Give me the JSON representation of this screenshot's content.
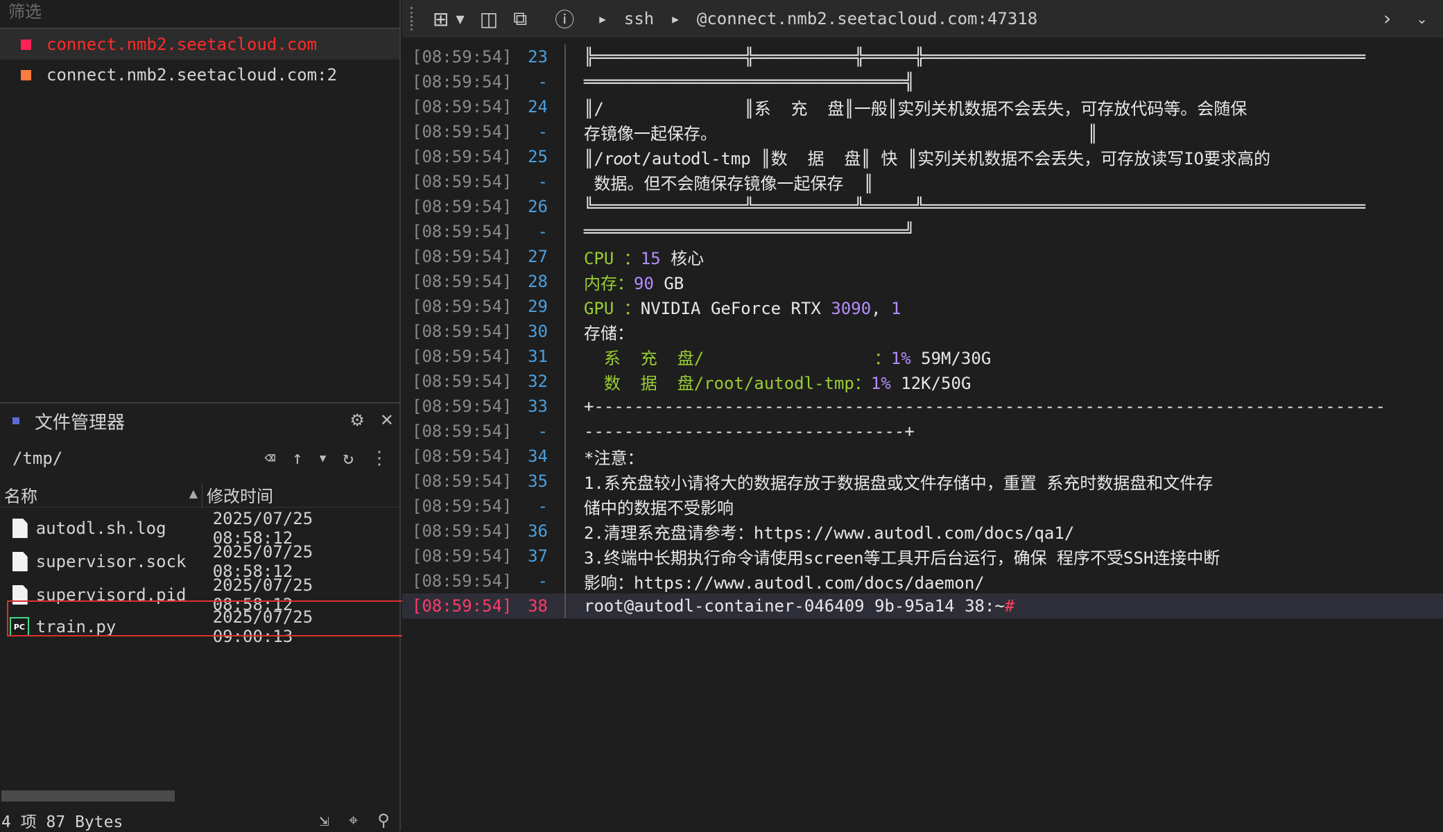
{
  "sessions": {
    "filter_placeholder": "筛选",
    "items": [
      {
        "label": "connect.nmb2.seetacloud.com",
        "color": "#ff2255"
      },
      {
        "label": "connect.nmb2.seetacloud.com:2",
        "color": "#ff7a3d"
      }
    ]
  },
  "file_manager": {
    "title": "文件管理器",
    "path": "/tmp/",
    "columns": {
      "name": "名称",
      "modified": "修改时间"
    },
    "files": [
      {
        "name": "autodl.sh.log",
        "modified": "2025/07/25 08:58:12",
        "icon": "file-icon"
      },
      {
        "name": "supervisor.sock",
        "modified": "2025/07/25 08:58:12",
        "icon": "file-icon"
      },
      {
        "name": "supervisord.pid",
        "modified": "2025/07/25 08:58:12",
        "icon": "file-icon"
      },
      {
        "name": "train.py",
        "modified": "2025/07/25 09:00:13",
        "icon": "pycharm-icon",
        "icon_text": "PC"
      }
    ],
    "status": "4 项 87 Bytes"
  },
  "toolbar": {
    "crumb_ssh": "ssh",
    "crumb_host": "@connect.nmb2.seetacloud.com:47318"
  },
  "terminal": {
    "lines": [
      {
        "ts": "[08:59:54]",
        "ln": "23",
        "text": "╠═══════════════╬══════════╬═════╬════════════════════════════════════════════"
      },
      {
        "ts": "[08:59:54]",
        "ln": "-",
        "text": "════════════════════════════════╣"
      },
      {
        "ts": "[08:59:54]",
        "ln": "24",
        "text": "║/              ║系  充  盘║一般║实列关机数据不会丢失，可存放代码等。会随保"
      },
      {
        "ts": "[08:59:54]",
        "ln": "-",
        "text": "存镜像一起保存。                                     ║"
      },
      {
        "ts": "[08:59:54]",
        "ln": "25",
        "text": "║/r𝑜𝑜t/aut𝑜dl-tmp ║数  据  盘║ 快 ║实列关机数据不会丢失，可存放读写IO要求高的"
      },
      {
        "ts": "[08:59:54]",
        "ln": "-",
        "text": " 数据。但不会随保存镜像一起保存  ║"
      },
      {
        "ts": "[08:59:54]",
        "ln": "26",
        "text": "╚═══════════════╩══════════╩═════╩════════════════════════════════════════════"
      },
      {
        "ts": "[08:59:54]",
        "ln": "-",
        "text": "════════════════════════════════╝"
      },
      {
        "ts": "[08:59:54]",
        "ln": "27",
        "text": "CPU ：15 核心",
        "kind": "cpu"
      },
      {
        "ts": "[08:59:54]",
        "ln": "28",
        "text": "内存：90 GB",
        "kind": "mem"
      },
      {
        "ts": "[08:59:54]",
        "ln": "29",
        "text": "GPU ：NVIDIA GeForce RTX 3090, 1",
        "kind": "gpu"
      },
      {
        "ts": "[08:59:54]",
        "ln": "30",
        "text": "存储：",
        "kind": "green"
      },
      {
        "ts": "[08:59:54]",
        "ln": "31",
        "text": "  系  充  盘/                 ：1% 59M/30G",
        "kind": "disk"
      },
      {
        "ts": "[08:59:54]",
        "ln": "32",
        "text": "  数  据  盘/root/autodl-tmp：1% 12K/50G",
        "kind": "disk"
      },
      {
        "ts": "[08:59:54]",
        "ln": "33",
        "text": "+-------------------------------------------------------------------------------",
        "kind": "green"
      },
      {
        "ts": "[08:59:54]",
        "ln": "-",
        "text": "--------------------------------+",
        "kind": "green"
      },
      {
        "ts": "[08:59:54]",
        "ln": "34",
        "text": "*注意：",
        "kind": "red"
      },
      {
        "ts": "[08:59:54]",
        "ln": "35",
        "text": "1.系充盘较小请将大的数据存放于数据盘或文件存储中，重置 系充时数据盘和文件存",
        "kind": "red"
      },
      {
        "ts": "[08:59:54]",
        "ln": "-",
        "text": "储中的数据不受影响",
        "kind": "red"
      },
      {
        "ts": "[08:59:54]",
        "ln": "36",
        "text": "2.清理系充盘请参考：https://www.autodl.com/docs/qa1/",
        "kind": "red"
      },
      {
        "ts": "[08:59:54]",
        "ln": "37",
        "text": "3.终端中长期执行命令请使用screen等工具开后台运行，确保 程序不受SSH连接中断",
        "kind": "red"
      },
      {
        "ts": "[08:59:54]",
        "ln": "-",
        "text": "影响：https://www.autodl.com/docs/daemon/",
        "kind": "red"
      },
      {
        "ts": "[08:59:54]",
        "ln": "38",
        "text": "root@autodl-container-046409 9b-95a14 38:~#",
        "kind": "prompt"
      }
    ]
  }
}
